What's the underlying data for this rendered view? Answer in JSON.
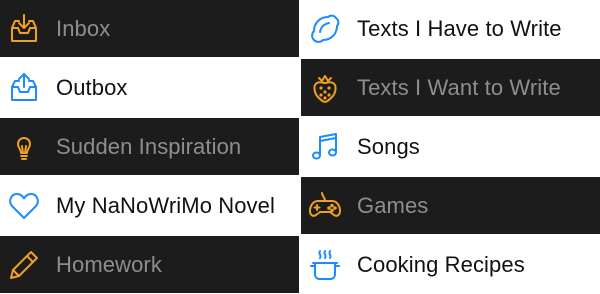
{
  "colors": {
    "dark_bg": "#1c1c1c",
    "light_bg": "#ffffff",
    "dark_text": "#8e8e8e",
    "light_text": "#111111",
    "accent_orange": "#f0a020",
    "accent_blue": "#1a8cff"
  },
  "left_column": [
    {
      "label": "Inbox",
      "icon": "inbox-tray-icon",
      "theme": "dark"
    },
    {
      "label": "Outbox",
      "icon": "outbox-tray-icon",
      "theme": "light"
    },
    {
      "label": "Sudden Inspiration",
      "icon": "lightbulb-icon",
      "theme": "dark"
    },
    {
      "label": "My NaNoWriMo Novel",
      "icon": "heart-icon",
      "theme": "light"
    },
    {
      "label": "Homework",
      "icon": "pencil-icon",
      "theme": "dark"
    }
  ],
  "right_column": [
    {
      "label": "Texts I Have to Write",
      "icon": "lemon-icon",
      "theme": "light"
    },
    {
      "label": "Texts I Want to Write",
      "icon": "strawberry-icon",
      "theme": "dark"
    },
    {
      "label": "Songs",
      "icon": "music-note-icon",
      "theme": "light"
    },
    {
      "label": "Games",
      "icon": "gamepad-icon",
      "theme": "dark"
    },
    {
      "label": "Cooking Recipes",
      "icon": "cooking-pot-icon",
      "theme": "light"
    }
  ]
}
